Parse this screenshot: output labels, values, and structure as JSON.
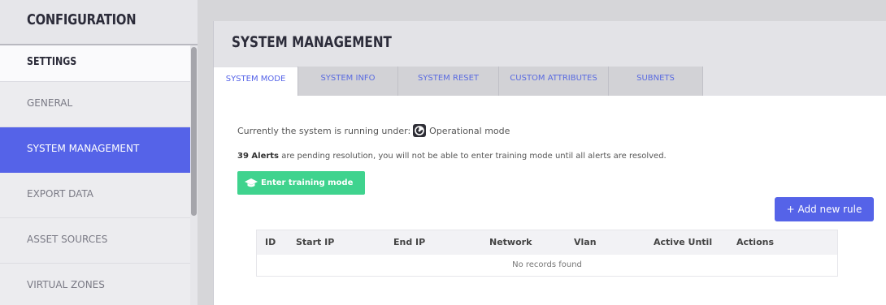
{
  "sidebar": {
    "title": "CONFIGURATION",
    "section": "SETTINGS",
    "items": [
      {
        "label": "GENERAL"
      },
      {
        "label": "SYSTEM MANAGEMENT"
      },
      {
        "label": "EXPORT DATA"
      },
      {
        "label": "ASSET SOURCES"
      },
      {
        "label": "VIRTUAL ZONES"
      }
    ],
    "active_item": "SYSTEM MANAGEMENT"
  },
  "main": {
    "title": "SYSTEM MANAGEMENT",
    "tabs": [
      {
        "label": "SYSTEM MODE"
      },
      {
        "label": "SYSTEM INFO"
      },
      {
        "label": "SYSTEM RESET"
      },
      {
        "label": "CUSTOM ATTRIBUTES"
      },
      {
        "label": "SUBNETS"
      }
    ],
    "active_tab": "SYSTEM MODE",
    "mode": {
      "prefix": "Currently the system is running under:",
      "mode_label": "Operational mode",
      "icon": "operational-mode-icon"
    },
    "alerts": {
      "count_text": "39 Alerts",
      "message": " are pending resolution, you will not be able to enter training mode until all alerts are resolved."
    },
    "training_button": {
      "label": "Enter training mode",
      "icon": "graduation-cap-icon"
    },
    "add_rule_button": {
      "label": "+ Add new rule"
    },
    "table": {
      "columns": [
        "ID",
        "Start IP",
        "End IP",
        "Network",
        "Vlan",
        "Active Until",
        "Actions"
      ],
      "empty_text": "No records found"
    }
  },
  "colors": {
    "accent": "#5563e8",
    "success": "#3fd38e",
    "sidebar_bg": "#ececef",
    "header_bg": "#e3e3e7"
  }
}
